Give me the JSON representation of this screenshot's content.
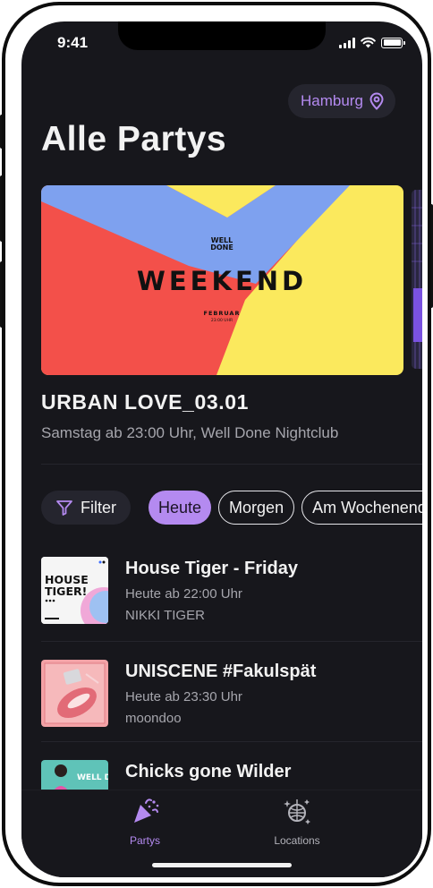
{
  "status_bar": {
    "time": "9:41"
  },
  "header": {
    "city": "Hamburg",
    "title": "Alle Partys"
  },
  "featured": {
    "poster": {
      "brand_line1": "WELL",
      "brand_line2": "DONE",
      "headline": "WEEKEND",
      "month": "FEBRUAR",
      "time": "23:00 UHR"
    },
    "title": "URBAN LOVE_03.01",
    "subtitle": "Samstag ab 23:00 Uhr, Well Done Nightclub"
  },
  "filters": {
    "filter_label": "Filter",
    "chips": [
      {
        "label": "Heute",
        "active": true
      },
      {
        "label": "Morgen",
        "active": false
      },
      {
        "label": "Am Wochenende",
        "active": false
      }
    ]
  },
  "events": [
    {
      "title": "House Tiger - Friday",
      "time": "Heute ab 22:00 Uhr",
      "organizer": "NIKKI TIGER",
      "thumb_line1": "HOUSE",
      "thumb_line2": "TIGER!"
    },
    {
      "title": "UNISCENE #Fakulspät",
      "time": "Heute ab 23:30 Uhr",
      "organizer": "moondoo"
    },
    {
      "title": "Chicks gone Wilder",
      "thumb_text": "WELL DONE"
    }
  ],
  "tabbar": {
    "tabs": [
      {
        "label": "Partys",
        "icon": "party-popper-icon",
        "active": true
      },
      {
        "label": "Locations",
        "icon": "disco-ball-icon",
        "active": false
      }
    ]
  },
  "colors": {
    "accent": "#b48af0",
    "background": "#17171c",
    "chip_bg": "#25252e"
  }
}
